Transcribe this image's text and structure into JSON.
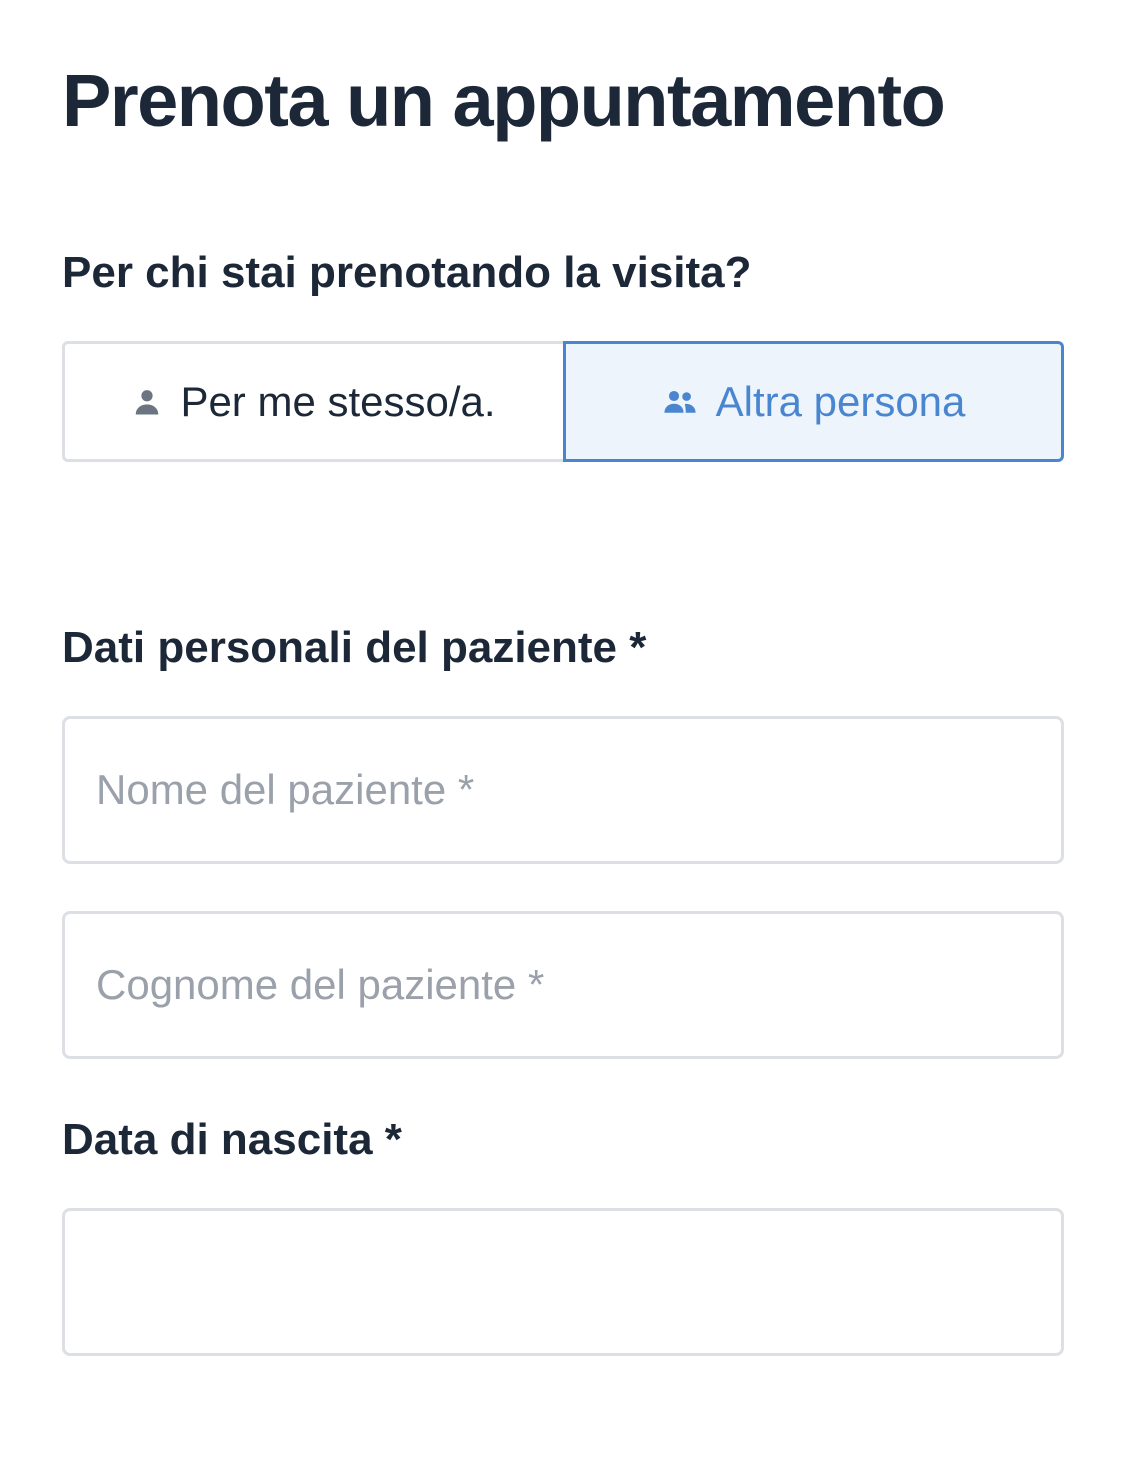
{
  "page": {
    "title": "Prenota un appuntamento"
  },
  "booking_for": {
    "question": "Per chi stai prenotando la visita?",
    "options": [
      {
        "label": "Per me stesso/a.",
        "icon": "person-icon",
        "selected": false
      },
      {
        "label": "Altra persona",
        "icon": "people-icon",
        "selected": true
      }
    ]
  },
  "patient": {
    "section_label": "Dati personali del paziente *",
    "first_name": {
      "placeholder": "Nome del paziente *",
      "value": ""
    },
    "last_name": {
      "placeholder": "Cognome del paziente *",
      "value": ""
    }
  },
  "birth_date": {
    "label": "Data di nascita *",
    "value": ""
  },
  "colors": {
    "text": "#1c2838",
    "accent": "#4a86cf",
    "accent_bg": "#edf4fc",
    "border": "#dcdfe3",
    "placeholder": "#9aa1aa"
  }
}
